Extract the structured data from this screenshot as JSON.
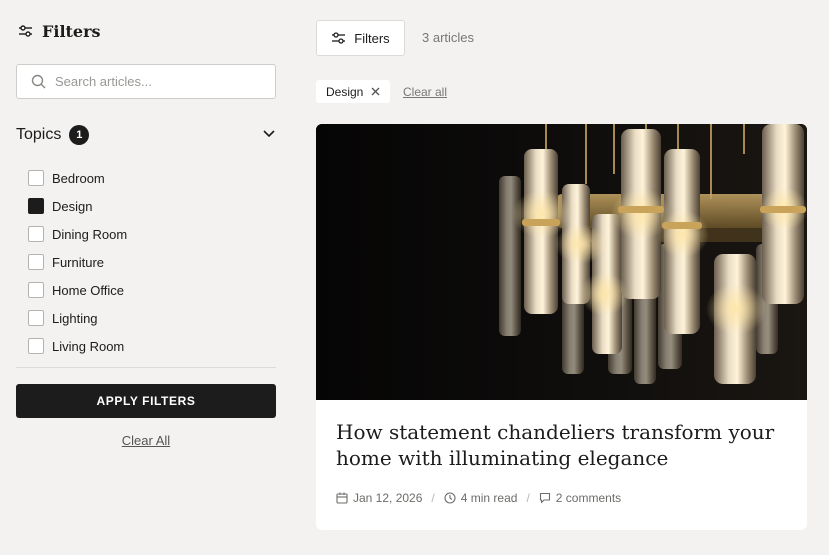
{
  "sidebar": {
    "title": "Filters",
    "search_placeholder": "Search articles...",
    "topics_label": "Topics",
    "topics_count": "1",
    "topics": [
      {
        "label": "Bedroom",
        "checked": false
      },
      {
        "label": "Design",
        "checked": true
      },
      {
        "label": "Dining Room",
        "checked": false
      },
      {
        "label": "Furniture",
        "checked": false
      },
      {
        "label": "Home Office",
        "checked": false
      },
      {
        "label": "Lighting",
        "checked": false
      },
      {
        "label": "Living Room",
        "checked": false
      }
    ],
    "apply_label": "APPLY FILTERS",
    "clear_all_label": "Clear All"
  },
  "toolbar": {
    "filters_label": "Filters",
    "article_count": "3 articles"
  },
  "active_filters": {
    "chip_label": "Design",
    "clear_label": "Clear all"
  },
  "article": {
    "title": "How statement chandeliers transform your home with illuminating elegance",
    "date": "Jan 12, 2026",
    "read_time": "4 min read",
    "comments": "2 comments",
    "image_alt": "crystal chandelier"
  },
  "colors": {
    "background": "#f3f2f0",
    "primary": "#1c1c1c",
    "card": "#ffffff"
  }
}
